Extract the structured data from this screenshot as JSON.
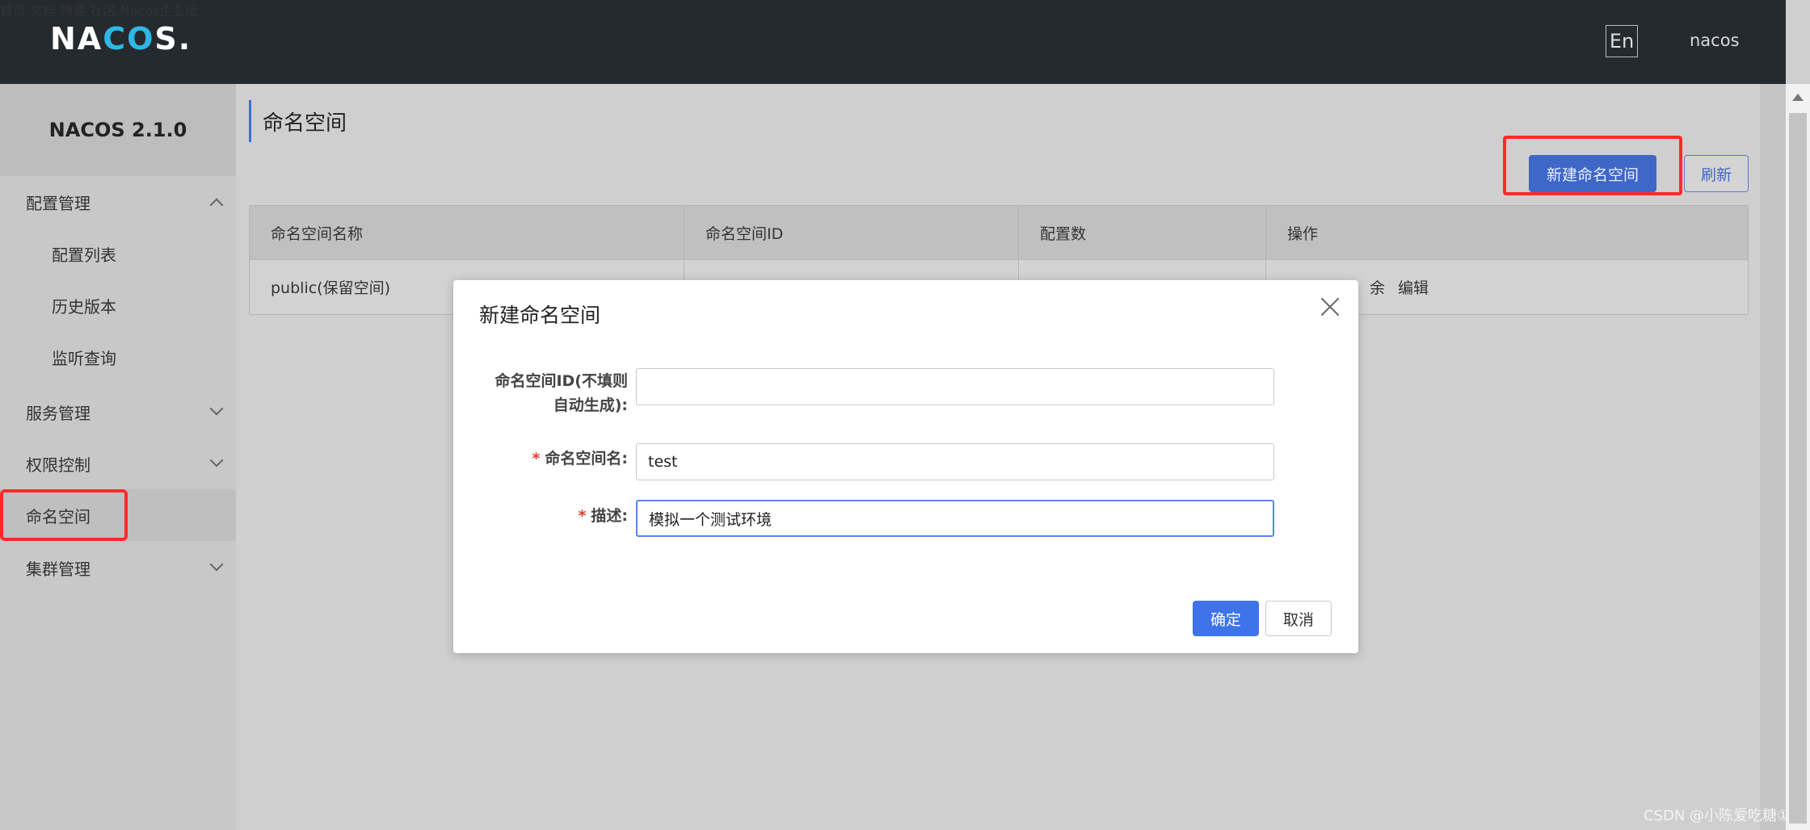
{
  "header": {
    "logo_left": "NA",
    "logo_mid": "CO",
    "logo_right": "S.",
    "nav": [
      "首页",
      "文档",
      "博客",
      "社区",
      "Nacos企业版"
    ],
    "lang": "En",
    "user": "nacos"
  },
  "sidebar": {
    "title": "NACOS 2.1.0",
    "items": [
      {
        "label": "配置管理"
      },
      {
        "label": "配置列表"
      },
      {
        "label": "历史版本"
      },
      {
        "label": "监听查询"
      },
      {
        "label": "服务管理"
      },
      {
        "label": "权限控制"
      },
      {
        "label": "命名空间"
      },
      {
        "label": "集群管理"
      }
    ]
  },
  "main": {
    "title": "命名空间",
    "new_button": "新建命名空间",
    "refresh_button": "刷新",
    "table": {
      "headers": [
        "命名空间名称",
        "命名空间ID",
        "配置数",
        "操作"
      ],
      "rows": [
        {
          "name": "public(保留空间)",
          "id": "",
          "count": "",
          "op_partial": "余",
          "op_edit": "编辑"
        }
      ]
    }
  },
  "modal": {
    "title": "新建命名空间",
    "id_label_line1": "命名空间ID(不填则",
    "id_label_line2": "自动生成):",
    "id_value": "",
    "name_label": "命名空间名:",
    "name_value": "test",
    "desc_label": "描述:",
    "desc_value": "模拟一个测试环境",
    "required_mark": "*",
    "ok": "确定",
    "cancel": "取消"
  },
  "watermark": "CSDN @小陈爱吃糖①"
}
